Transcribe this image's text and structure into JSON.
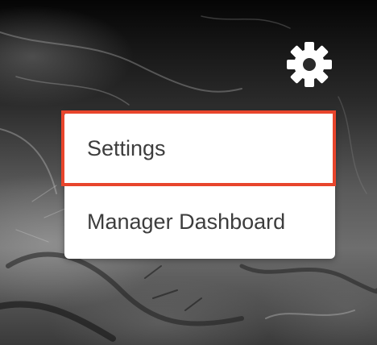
{
  "header": {
    "settings_icon": "gear-icon"
  },
  "dropdown_menu": {
    "items": [
      {
        "label": "Settings",
        "highlighted": true
      },
      {
        "label": "Manager Dashboard",
        "highlighted": false
      }
    ],
    "highlight_color": "#e8452c"
  },
  "colors": {
    "menu_background": "#ffffff",
    "menu_text": "#3d3d3d",
    "icon": "#ffffff"
  }
}
